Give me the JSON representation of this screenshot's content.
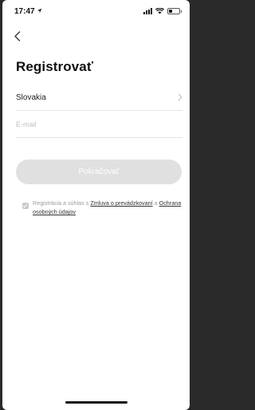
{
  "status_bar": {
    "time": "17:47",
    "battery_level": 0.35
  },
  "header": {
    "title": "Registrovať"
  },
  "form": {
    "country": "Slovakia",
    "email_placeholder": "E-mail",
    "email_value": "",
    "continue_label": "Pokračovať"
  },
  "consent": {
    "checked": true,
    "text_prefix": "Registrácia a súhlas s ",
    "link_terms": "Zmluva o prevádzkovaní",
    "text_middle": " a ",
    "link_privacy": "Ochrana osobných údajov"
  },
  "icons": {
    "back": "chevron-left-icon",
    "location": "location-arrow-icon",
    "signal": "cellular-signal-icon",
    "wifi": "wifi-icon",
    "battery": "battery-icon",
    "country_arrow": "chevron-right-icon"
  }
}
